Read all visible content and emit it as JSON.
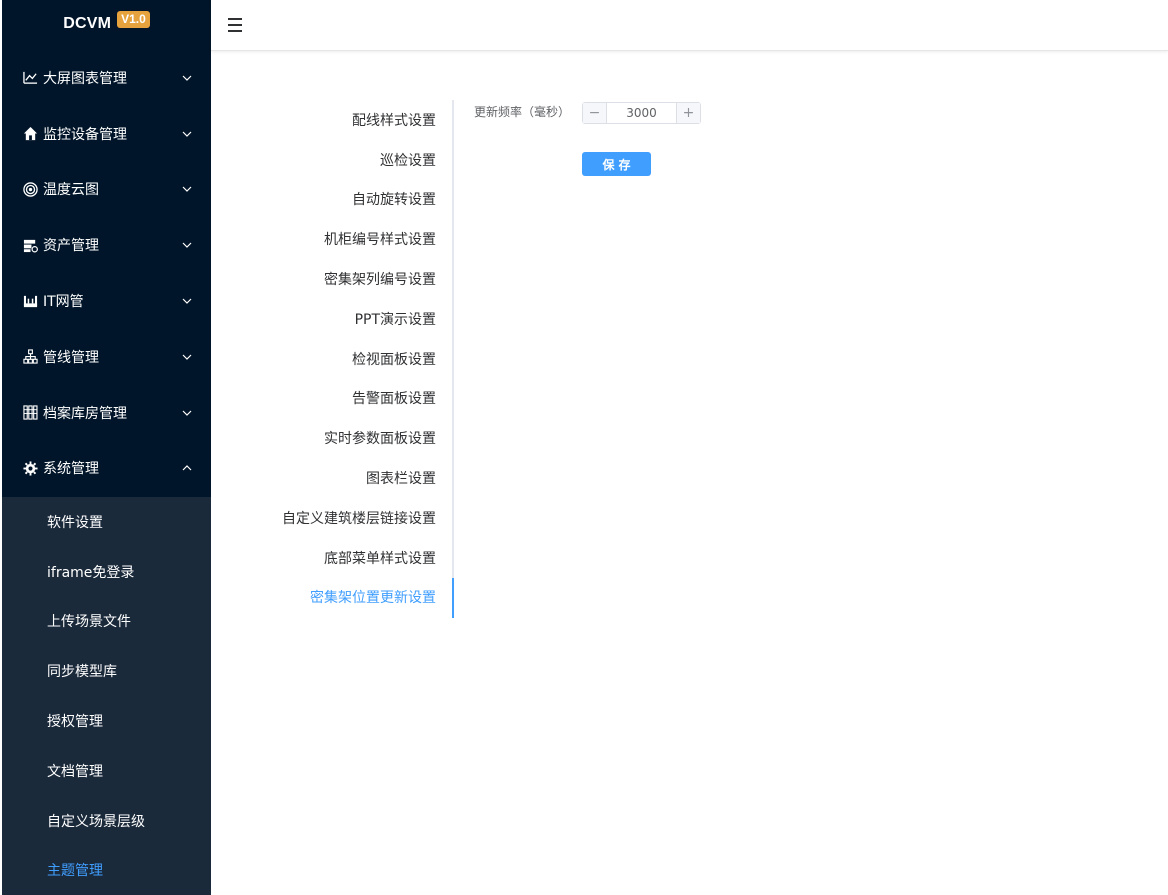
{
  "app": {
    "name": "DCVM",
    "version": "V1.0"
  },
  "sidebar": {
    "menu": [
      {
        "label": "大屏图表管理",
        "icon": "line-chart-icon",
        "expanded": false
      },
      {
        "label": "监控设备管理",
        "icon": "home-icon",
        "expanded": false
      },
      {
        "label": "温度云图",
        "icon": "target-icon",
        "expanded": false
      },
      {
        "label": "资产管理",
        "icon": "server-gear-icon",
        "expanded": false
      },
      {
        "label": "IT网管",
        "icon": "network-icon",
        "expanded": false
      },
      {
        "label": "管线管理",
        "icon": "sitemap-icon",
        "expanded": false
      },
      {
        "label": "档案库房管理",
        "icon": "archive-icon",
        "expanded": false
      },
      {
        "label": "系统管理",
        "icon": "gear-icon",
        "expanded": true
      }
    ],
    "submenu": [
      {
        "label": "软件设置"
      },
      {
        "label": "iframe免登录"
      },
      {
        "label": "上传场景文件"
      },
      {
        "label": "同步模型库"
      },
      {
        "label": "授权管理"
      },
      {
        "label": "文档管理"
      },
      {
        "label": "自定义场景层级"
      },
      {
        "label": "主题管理",
        "active": true
      }
    ]
  },
  "tabs": [
    {
      "label": "配线样式设置"
    },
    {
      "label": "巡检设置"
    },
    {
      "label": "自动旋转设置"
    },
    {
      "label": "机柜编号样式设置"
    },
    {
      "label": "密集架列编号设置"
    },
    {
      "label": "PPT演示设置"
    },
    {
      "label": "检视面板设置"
    },
    {
      "label": "告警面板设置"
    },
    {
      "label": "实时参数面板设置"
    },
    {
      "label": "图表栏设置"
    },
    {
      "label": "自定义建筑楼层链接设置"
    },
    {
      "label": "底部菜单样式设置"
    },
    {
      "label": "密集架位置更新设置",
      "active": true
    }
  ],
  "form": {
    "label": "更新频率（毫秒）",
    "value": "3000",
    "minus": "−",
    "plus": "+",
    "save_label": "保存"
  },
  "colors": {
    "sidebar_bg": "#001529",
    "submenu_bg": "#1b2a3b",
    "accent": "#409eff",
    "badge": "#e6a23c"
  }
}
